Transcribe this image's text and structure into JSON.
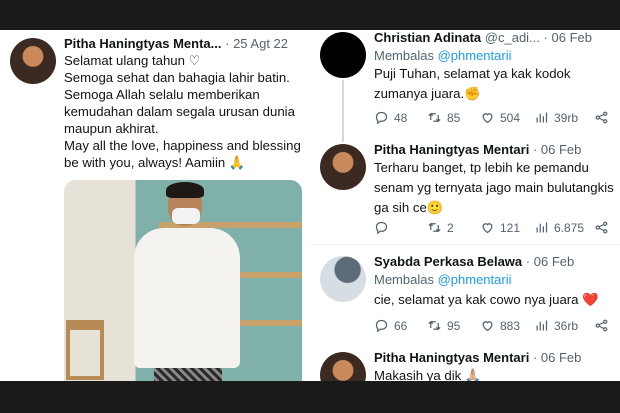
{
  "main_tweet": {
    "author": "Pitha Haningtyas Menta",
    "truncated_suffix": "...",
    "separator": "·",
    "date": "25 Agt 22",
    "text": "Selamat ulang tahun ♡\nSemoga sehat dan bahagia lahir batin. Semoga Allah selalu memberikan kemudahan dalam segala urusan dunia maupun akhirat.\nMay all the love, happiness and blessing be with you, always! Aamiin 🙏"
  },
  "replies": [
    {
      "author": "Christian Adinata",
      "handle": "@c_adi...",
      "date": "06 Feb",
      "reply_prefix": "Membalas",
      "reply_to": "@phmentarii",
      "text": "Puji Tuhan, selamat ya kak kodok zumanya juara.✊",
      "replies": "48",
      "retweets": "85",
      "likes": "504",
      "views": "39rb"
    },
    {
      "author": "Pitha Haningtyas Mentari",
      "date": "06 Feb",
      "text": "Terharu banget, tp lebih ke pemandu senam yg ternyata jago main bulutangkis ga sih ce🙂",
      "replies": "",
      "retweets": "2",
      "likes": "121",
      "views": "6.875"
    },
    {
      "author": "Syabda Perkasa Belawa",
      "date": "06 Feb",
      "reply_prefix": "Membalas",
      "reply_to": "@phmentarii",
      "text": "cie, selamat ya kak cowo nya juara ❤️",
      "replies": "66",
      "retweets": "95",
      "likes": "883",
      "views": "36rb"
    },
    {
      "author": "Pitha Haningtyas Mentari",
      "date": "06 Feb",
      "text": "Makasih ya dik 🙏🏼"
    }
  ],
  "colors": {
    "text": "#0f1419",
    "muted": "#536471",
    "link": "#1d9bf0",
    "bar": "#1a1a1a"
  }
}
